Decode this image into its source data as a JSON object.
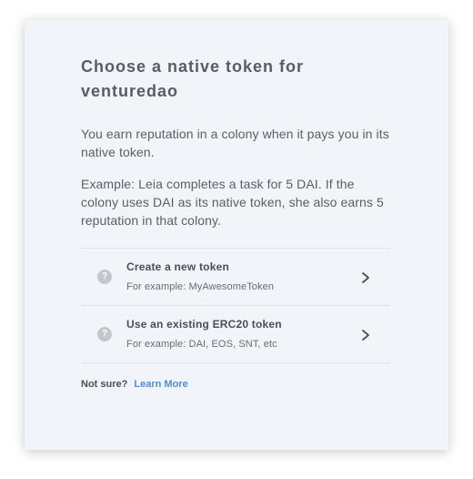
{
  "dialog": {
    "title": "Choose a native token for venturedao",
    "paragraph1": "You earn reputation in a colony when it pays you in its native token.",
    "paragraph2": "Example: Leia completes a task for 5 DAI. If the colony uses DAI as its native token, she also earns 5 reputation in that colony."
  },
  "options": [
    {
      "icon": "question-circle-icon",
      "title": "Create a new token",
      "subtitle": "For example: MyAwesomeToken",
      "chevron": "chevron-right-icon"
    },
    {
      "icon": "question-circle-icon",
      "title": "Use an existing ERC20 token",
      "subtitle": "For example: DAI, EOS, SNT, etc",
      "chevron": "chevron-right-icon"
    }
  ],
  "footer": {
    "prompt": "Not sure?",
    "link_label": "Learn More"
  },
  "colors": {
    "card_background": "#f1f4f9",
    "link": "#4d8ee3",
    "icon_gray": "#c4c6cc"
  }
}
